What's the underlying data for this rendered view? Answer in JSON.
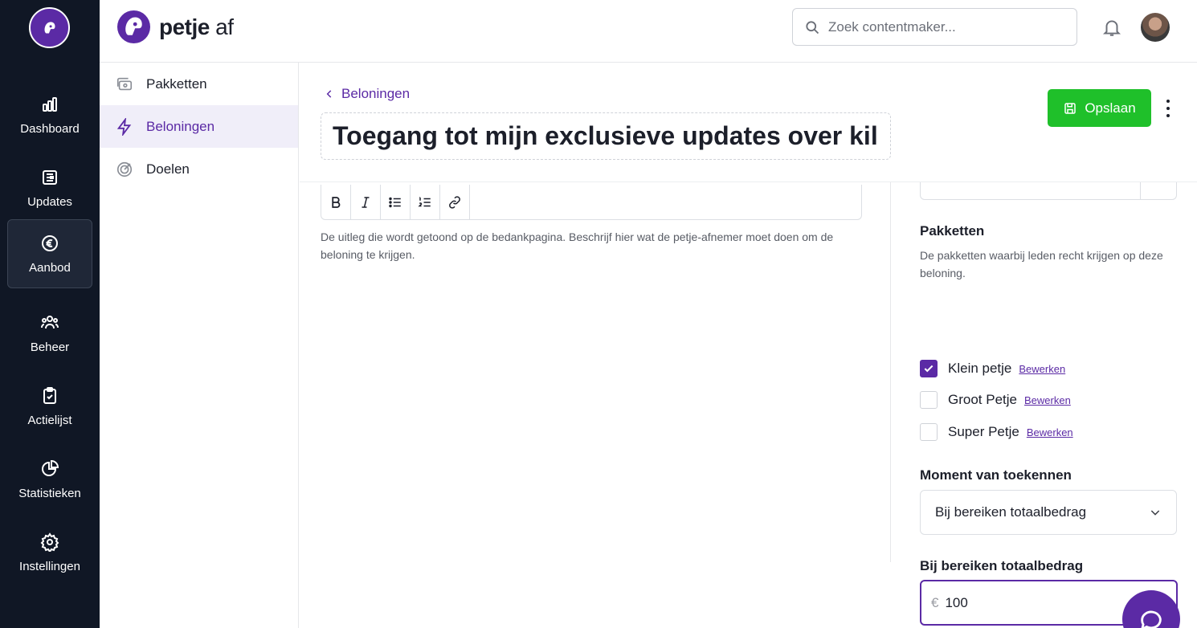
{
  "rail": {
    "items": [
      {
        "label": "Dashboard",
        "icon": "bar-chart-icon"
      },
      {
        "label": "Updates",
        "icon": "newspaper-icon"
      },
      {
        "label": "Aanbod",
        "icon": "euro-icon"
      },
      {
        "label": "Beheer",
        "icon": "users-icon"
      },
      {
        "label": "Actielijst",
        "icon": "clipboard-check-icon"
      },
      {
        "label": "Statistieken",
        "icon": "pie-chart-icon"
      },
      {
        "label": "Instellingen",
        "icon": "gear-icon"
      }
    ]
  },
  "topbar": {
    "brand_bold": "petje",
    "brand_light": " af",
    "search_placeholder": "Zoek contentmaker..."
  },
  "subnav": {
    "items": [
      {
        "label": "Pakketten",
        "icon": "packages-icon"
      },
      {
        "label": "Beloningen",
        "icon": "lightning-icon"
      },
      {
        "label": "Doelen",
        "icon": "target-icon"
      }
    ]
  },
  "main": {
    "breadcrumb": "Beloningen",
    "title": "Toegang tot mijn exclusieve updates over kil",
    "save_label": "Opslaan",
    "editor_help": "De uitleg die wordt getoond op de bedankpagina. Beschrijf hier wat de petje-afnemer moet doen om de beloning te krijgen."
  },
  "right": {
    "packages_title": "Pakketten",
    "packages_desc": "De pakketten waarbij leden recht krijgen op deze beloning.",
    "packages": [
      {
        "name": "Klein petje",
        "edit": "Bewerken",
        "checked": true
      },
      {
        "name": "Groot Petje",
        "edit": "Bewerken",
        "checked": false
      },
      {
        "name": "Super Petje",
        "edit": "Bewerken",
        "checked": false
      }
    ],
    "moment_title": "Moment van toekennen",
    "moment_value": "Bij bereiken totaalbedrag",
    "amount_title": "Bij bereiken totaalbedrag",
    "amount_currency": "€",
    "amount_value": "100"
  },
  "colors": {
    "brand": "#5b2aa5",
    "rail": "#101725",
    "save": "#1fc02a"
  }
}
